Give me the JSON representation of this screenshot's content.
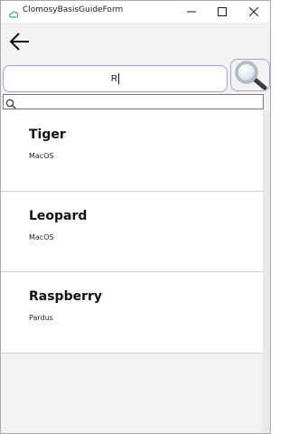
{
  "window": {
    "title": "ClomosyBasisGuideForm",
    "minimize_label": "—",
    "maximize_label": "☐",
    "close_label": "✕"
  },
  "toolbar": {
    "back_icon": "arrow-left-icon",
    "search_value": "R",
    "search_icon": "magnifier-icon"
  },
  "filter": {
    "value": "",
    "icon": "search-icon"
  },
  "list": {
    "items": [
      {
        "title": "Tiger",
        "subtitle": "MacOS"
      },
      {
        "title": "Leopard",
        "subtitle": "MacOS"
      },
      {
        "title": "Raspberry",
        "subtitle": "Pardus"
      }
    ]
  },
  "colors": {
    "accent_border": "#b897d8",
    "app_background": "#f2f2f2",
    "item_background": "#ffffff"
  }
}
